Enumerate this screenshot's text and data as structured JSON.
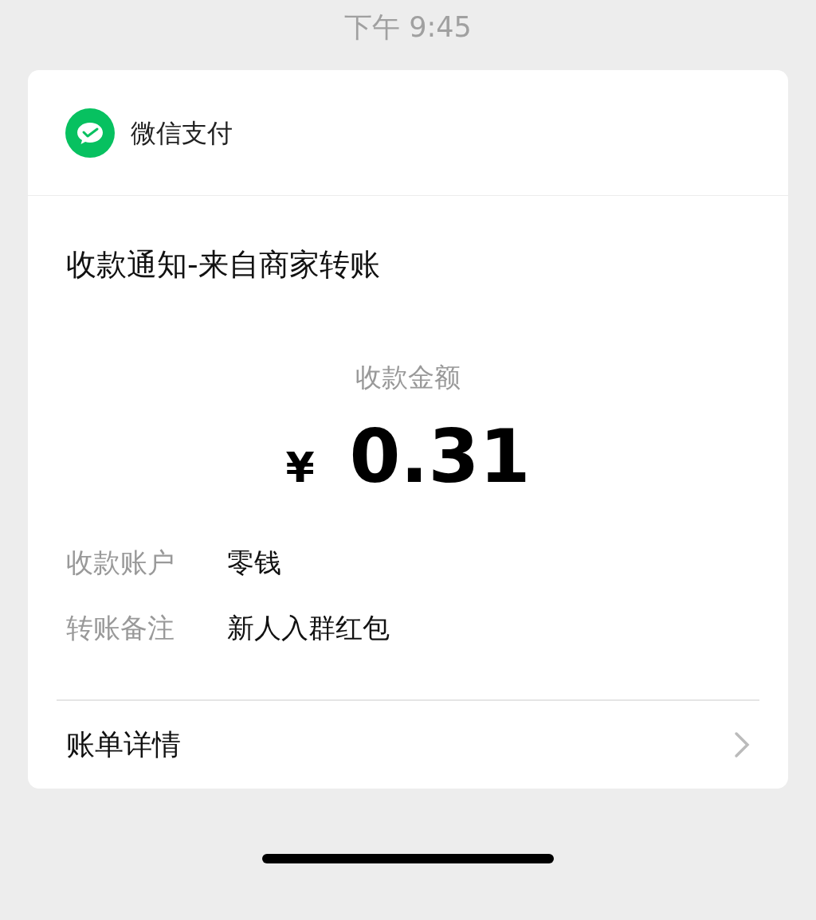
{
  "status_bar": {
    "time": "下午 9:45"
  },
  "card": {
    "app_name": "微信支付",
    "title": "收款通知-来自商家转账",
    "amount_label": "收款金额",
    "currency": "¥",
    "amount": "0.31",
    "details": [
      {
        "label": "收款账户",
        "value": "零钱"
      },
      {
        "label": "转账备注",
        "value": "新人入群红包"
      }
    ],
    "link": "账单详情"
  }
}
